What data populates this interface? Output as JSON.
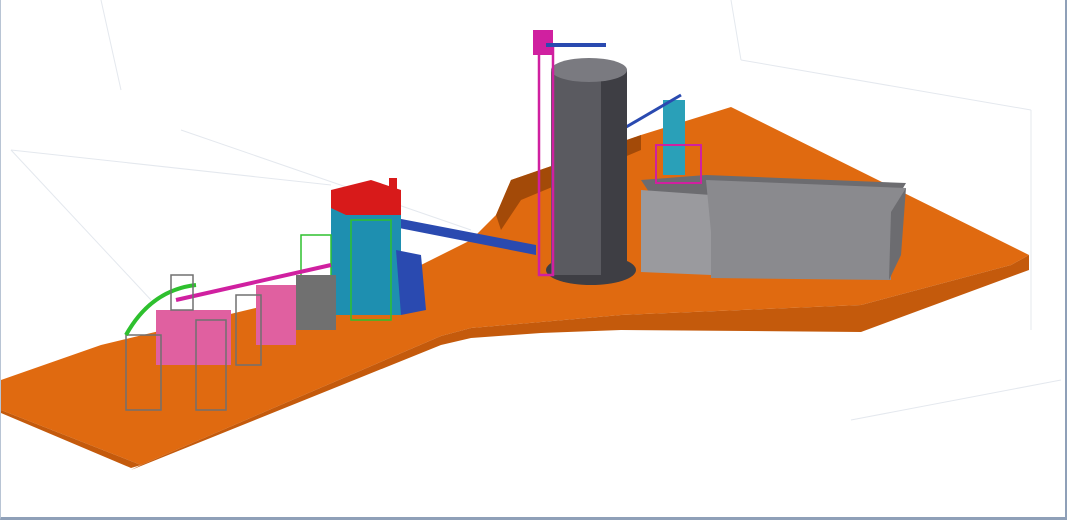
{
  "viewport": {
    "view": "3d-model-viewport",
    "background_color": "#ffffff",
    "frame_color": "#8fa0b8"
  },
  "scene": {
    "colors": {
      "ground_top": "#e06a10",
      "ground_front": "#c45a0c",
      "ground_side": "#a34a08",
      "silo": "#5a5a60",
      "silo_shade": "#3e3e44",
      "silo_light": "#7a7a80",
      "building_wall": "#8a8a8e",
      "building_roof": "#6c6c70",
      "building_front": "#9a9a9e",
      "red_roof": "#d81a1a",
      "structure_cyan": "#1e8fb0",
      "structure_magenta": "#d020a0",
      "structure_green": "#2ec02e",
      "structure_grey": "#707070",
      "conveyor_blue": "#2a4ab0",
      "pink_bin": "#e060a0",
      "teal_tower": "#2aa0b8"
    },
    "objects": [
      {
        "name": "ground-platform",
        "kind": "terrain"
      },
      {
        "name": "large-silo",
        "kind": "cylinder"
      },
      {
        "name": "storage-building",
        "kind": "box"
      },
      {
        "name": "bucket-elevator",
        "kind": "tower"
      },
      {
        "name": "small-tower",
        "kind": "tower"
      },
      {
        "name": "main-process-plant",
        "kind": "structure"
      },
      {
        "name": "long-conveyor",
        "kind": "conveyor"
      },
      {
        "name": "left-conveyor",
        "kind": "conveyor"
      },
      {
        "name": "bag-filter-units",
        "kind": "structure"
      }
    ]
  }
}
